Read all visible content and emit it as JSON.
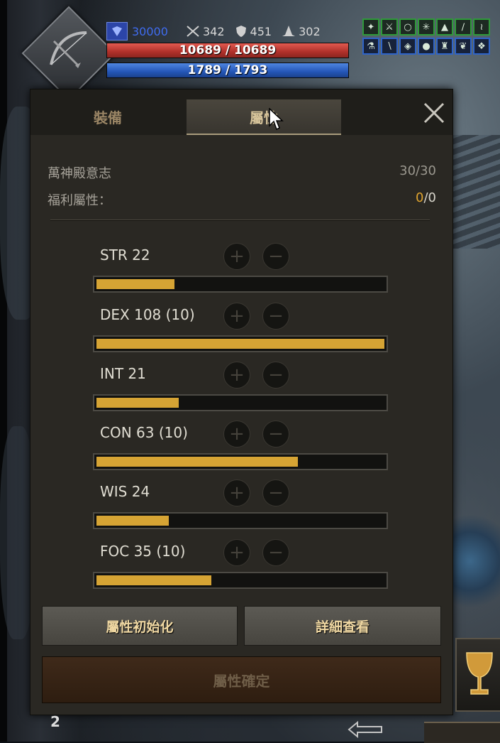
{
  "hud": {
    "currency": "30000",
    "attack": "342",
    "defense": "451",
    "magic": "302",
    "hp": "10689 / 10689",
    "mp": "1789 / 1793"
  },
  "panel": {
    "tabs": [
      "裝備",
      "屬性"
    ],
    "will_label": "萬神殿意志",
    "will_value": "30/30",
    "bonus_label": "福利屬性：",
    "bonus_current": "0",
    "bonus_total": "/0",
    "stats": [
      {
        "label": "STR   22",
        "fill": 0.27
      },
      {
        "label": "DEX 108  (10)",
        "fill": 1.0
      },
      {
        "label": "INT    21",
        "fill": 0.285
      },
      {
        "label": "CON   63  (10)",
        "fill": 0.7
      },
      {
        "label": "WIS    24",
        "fill": 0.25
      },
      {
        "label": "FOC   35  (10)",
        "fill": 0.4
      }
    ],
    "reset_label": "屬性初始化",
    "detail_label": "詳細查看",
    "confirm_label": "屬性確定"
  },
  "hotkey": "2",
  "colors": {
    "accent": "#d6a434",
    "hp": "#b0302a",
    "mp": "#2456b8"
  }
}
